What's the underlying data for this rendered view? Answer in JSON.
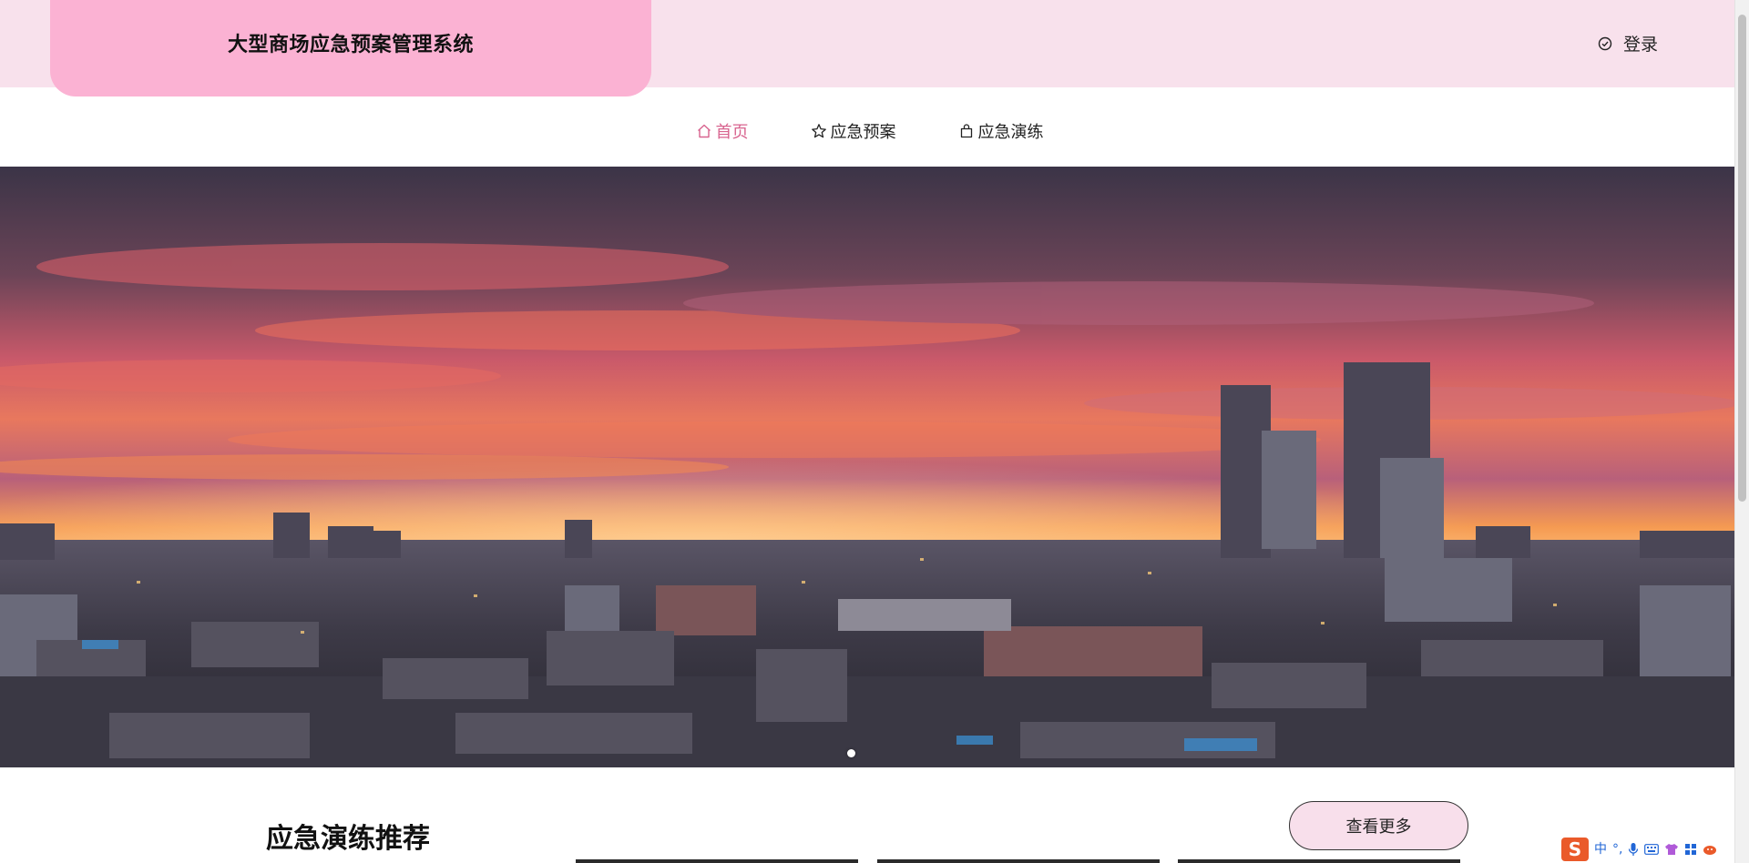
{
  "header": {
    "title": "大型商场应急预案管理系统",
    "login_label": "登录"
  },
  "nav": {
    "items": [
      {
        "label": "首页",
        "icon": "home-icon",
        "active": true
      },
      {
        "label": "应急预案",
        "icon": "star-icon",
        "active": false
      },
      {
        "label": "应急演练",
        "icon": "bag-icon",
        "active": false
      }
    ]
  },
  "banner": {
    "image": "city-sunset-skyline",
    "slide_count": 1,
    "active_slide": 1
  },
  "section": {
    "title": "应急演练推荐",
    "more_label": "查看更多"
  },
  "ime": {
    "mode_label": "中",
    "punct_label": "°,"
  },
  "colors": {
    "header_band": "#f8e1ec",
    "title_plate": "#fbb2d3",
    "active_nav": "#d8648f",
    "more_button": "#f8dfeb"
  }
}
